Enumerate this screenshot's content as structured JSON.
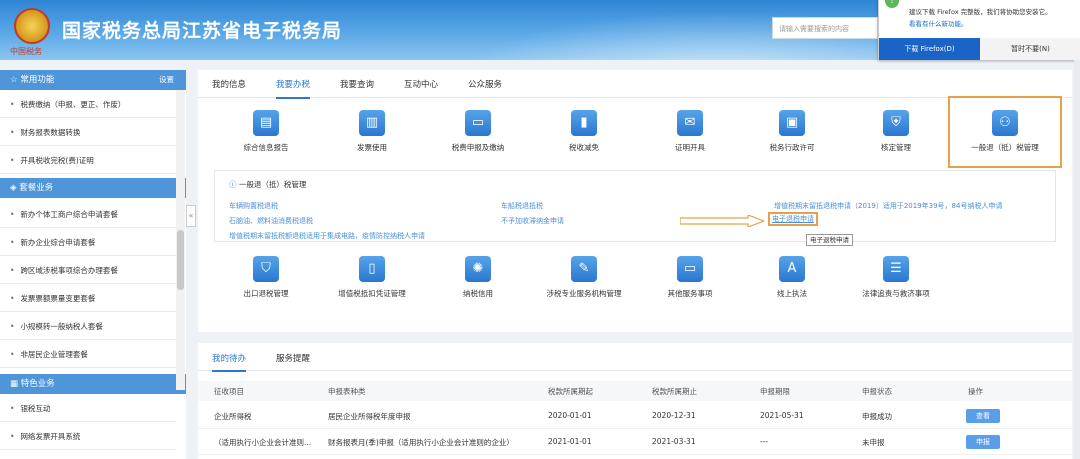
{
  "header": {
    "emblem_caption": "中国税务",
    "title": "国家税务总局江苏省电子税务局",
    "search_placeholder": "请输入需要搜索的内容"
  },
  "firefox_prompt": {
    "icon": "!",
    "message": "建议下载 Firefox 完整版，我们将协助您安装它。",
    "link": "看看有什么新功能。",
    "download_button": "下载 Firefox(D)",
    "decline_button": "暂时不要(N)"
  },
  "sidebar": {
    "sections": [
      {
        "title": "常用功能",
        "action": "设置",
        "items": [
          "税费缴纳（申报、更正、作废）",
          "财务报表数据转换",
          "开具税收完税(费)证明"
        ]
      },
      {
        "title": "套餐业务",
        "items": [
          "新办个体工商户综合申请套餐",
          "新办企业综合申请套餐",
          "跨区域涉税事项综合办理套餐",
          "发票票额票量变更套餐",
          "小规模转一般纳税人套餐",
          "非居民企业管理套餐"
        ]
      },
      {
        "title": "特色业务",
        "items": [
          "银税互动",
          "网络发票开具系统"
        ]
      }
    ],
    "collapse_glyph": "«"
  },
  "main": {
    "tabs": [
      "我的信息",
      "我要办税",
      "我要查询",
      "互动中心",
      "公众服务"
    ],
    "active_tab": "我要办税",
    "functions_row1": [
      "综合信息报告",
      "发票使用",
      "税费申报及缴纳",
      "税收减免",
      "证明开具",
      "税务行政许可",
      "核定管理",
      "一般退（抵）税管理"
    ],
    "functions_row2": [
      "出口退税管理",
      "增值税抵扣凭证管理",
      "纳税信用",
      "涉税专业服务机构管理",
      "其他服务事项",
      "线上执法",
      "法律追责与救济事项"
    ],
    "sub_panel": {
      "title": "一般退（抵）税管理",
      "links": [
        "车辆购置税退税",
        "车船税退抵税",
        "增值税期末留抵退税申请（2019）适用于2019年39号，84号纳税人申请",
        "石脑油、燃料油消费税退税",
        "不予加收滞纳金申请",
        "电子退税申请",
        "增值税期末留抵税额退税适用于集成电路，疫情防控纳税人申请"
      ]
    },
    "tooltip": "电子退税申请"
  },
  "todo": {
    "tabs": [
      "我的待办",
      "服务提醒"
    ],
    "columns": [
      "征收项目",
      "申报表种类",
      "税款所属期起",
      "税款所属期止",
      "申报期限",
      "申报状态",
      "操作"
    ],
    "rows": [
      [
        "企业所得税",
        "居民企业所得税年度申报",
        "2020-01-01",
        "2020-12-31",
        "2021-05-31",
        "申报成功",
        "查看"
      ],
      [
        "（适用执行小企业会计准则...",
        "财务报表月(季)申报（适用执行小企业会计准则的企业）",
        "2021-01-01",
        "2021-03-31",
        "---",
        "未申报",
        "申报"
      ]
    ]
  }
}
